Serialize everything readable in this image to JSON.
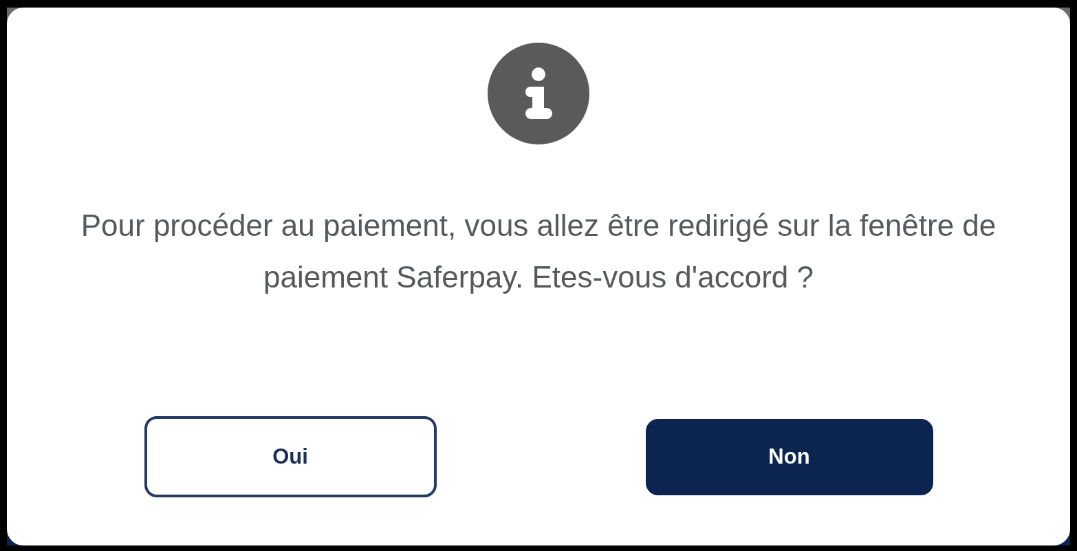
{
  "dialog": {
    "message": "Pour procéder au paiement, vous allez être redirigé sur la fenêtre de paiement Saferpay. Etes-vous d'accord ?",
    "buttons": [
      {
        "label": "Oui",
        "kind": "outline"
      },
      {
        "label": "Non",
        "kind": "filled"
      }
    ]
  }
}
